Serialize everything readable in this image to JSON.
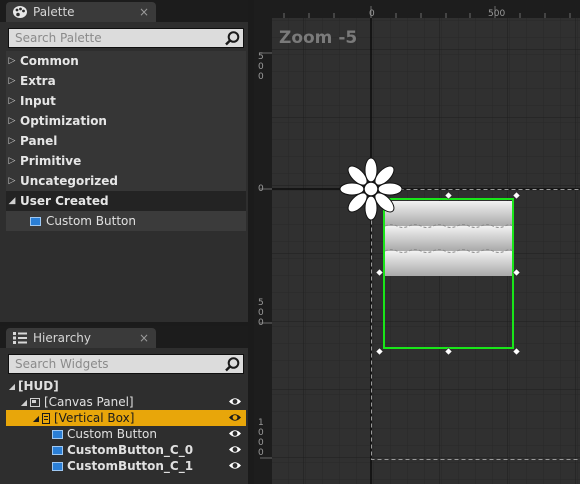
{
  "palette": {
    "tab_title": "Palette",
    "close_glyph": "×",
    "search_placeholder": "Search Palette",
    "categories": [
      {
        "label": "Common"
      },
      {
        "label": "Extra"
      },
      {
        "label": "Input"
      },
      {
        "label": "Optimization"
      },
      {
        "label": "Panel"
      },
      {
        "label": "Primitive"
      },
      {
        "label": "Uncategorized"
      },
      {
        "label": "User Created"
      }
    ],
    "user_created_items": [
      {
        "label": "Custom Button",
        "icon": "widget-icon"
      }
    ]
  },
  "hierarchy": {
    "tab_title": "Hierarchy",
    "close_glyph": "×",
    "search_placeholder": "Search Widgets",
    "tree": [
      {
        "label": "[HUD]",
        "bold": true
      },
      {
        "label": "[Canvas Panel]",
        "bold": false
      },
      {
        "label": "[Vertical Box]",
        "bold": false,
        "selected": true
      },
      {
        "label": "Custom Button",
        "bold": false
      },
      {
        "label": "CustomButton_C_0",
        "bold": true
      },
      {
        "label": "CustomButton_C_1",
        "bold": true
      }
    ]
  },
  "designer": {
    "zoom_label": "Zoom -5",
    "ruler_top": [
      "0",
      "500"
    ],
    "ruler_left": [
      {
        "digits": [
          "5",
          "0",
          "0"
        ]
      },
      {
        "digits": [
          "0"
        ]
      },
      {
        "digits": [
          "5",
          "0",
          "0"
        ]
      },
      {
        "digits": [
          "1",
          "0",
          "0",
          "0"
        ]
      }
    ],
    "colors": {
      "selection": "#19e619",
      "selected_row": "#e8a60a",
      "widget_icon": "#2b7fd6"
    }
  }
}
